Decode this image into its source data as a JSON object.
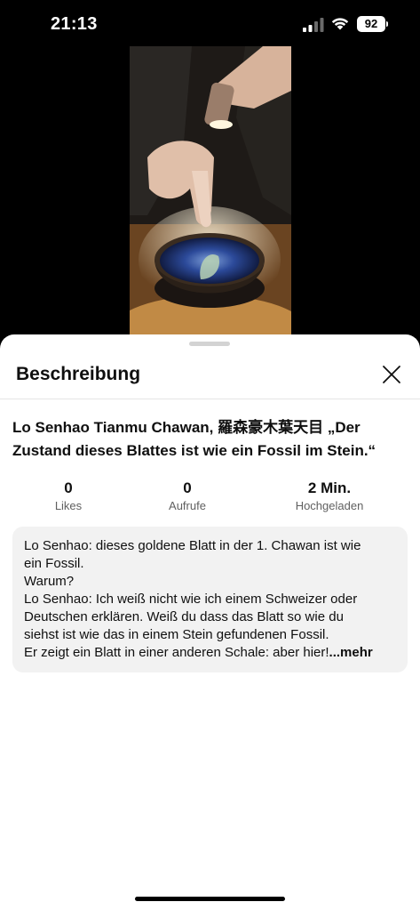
{
  "status_bar": {
    "time": "21:13",
    "battery": "92",
    "icons": [
      "signal-icon",
      "wifi-icon",
      "battery-icon"
    ]
  },
  "video": {
    "thumbnail_icon": "video-thumbnail"
  },
  "sheet": {
    "title": "Beschreibung",
    "close_icon": "close-icon"
  },
  "video_title": "Lo Senhao Tianmu Chawan, 羅森豪木葉天目 „Der Zustand dieses Blattes ist wie ein Fossil im Stein.“",
  "stats": [
    {
      "value": "0",
      "label": "Likes"
    },
    {
      "value": "0",
      "label": "Aufrufe"
    },
    {
      "value": "2 Min.",
      "label": "Hochgeladen"
    }
  ],
  "description": {
    "lines": [
      "Lo Senhao: dieses goldene Blatt in der 1. Chawan ist wie",
      "ein Fossil.",
      "Warum?",
      "Lo Senhao: Ich weiß nicht wie ich einem Schweizer oder",
      "Deutschen erklären. Weiß du dass das Blatt so wie du",
      "siehst ist wie das in einem Stein gefundenen Fossil.",
      "Er zeigt ein Blatt in einer anderen Schale: aber hier!"
    ],
    "more_label": "...mehr"
  },
  "colors": {
    "sheet_bg": "#ffffff",
    "description_bg": "#f2f2f2",
    "secondary_text": "#606060"
  }
}
